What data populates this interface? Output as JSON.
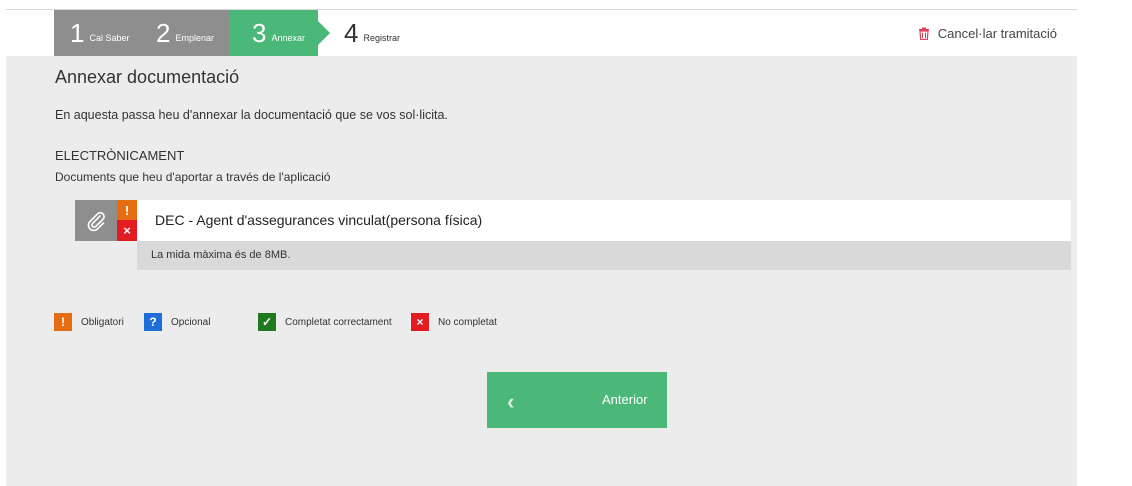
{
  "steps": [
    {
      "num": "1",
      "label": "Cal Saber"
    },
    {
      "num": "2",
      "label": "Emplenar"
    },
    {
      "num": "3",
      "label": "Annexar"
    },
    {
      "num": "4",
      "label": "Registrar"
    }
  ],
  "header": {
    "cancel_label": "Cancel·lar tramitació",
    "cancel_icon": "trash-icon"
  },
  "main": {
    "title": "Annexar documentació",
    "intro": "En aquesta passa heu d'annexar la documentació que se vos sol·licita.",
    "section_title": "ELECTRÒNICAMENT",
    "section_subtitle": "Documents que heu d'aportar a través de l'aplicació"
  },
  "document": {
    "title": "DEC - Agent d'assegurances vinculat(persona física)",
    "info": "La mida màxima és de 8MB.",
    "status_required": "!",
    "status_incomplete": "×"
  },
  "legend": [
    {
      "symbol": "!",
      "label": "Obligatori",
      "color": "#e66c11"
    },
    {
      "symbol": "?",
      "label": "Opcional",
      "color": "#1e6ed8"
    },
    {
      "symbol": "✓",
      "label": "Completat correctament",
      "color": "#1f7a1f"
    },
    {
      "symbol": "×",
      "label": "No completat",
      "color": "#e31b23"
    }
  ],
  "nav": {
    "previous_label": "Anterior",
    "previous_icon": "chevron-left-icon"
  },
  "colors": {
    "accent": "#4bb87a",
    "done_step": "#8e8e8e",
    "panel": "#ececec"
  }
}
